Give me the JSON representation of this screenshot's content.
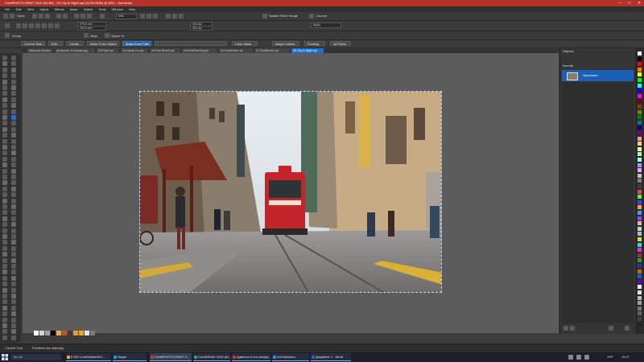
{
  "window": {
    "title": "CorelPHOTO-PAINT 2019 (64-Bit) - 06 City to Night.cpt (24-Bit RGB) @ 66% - Openimen",
    "controls": [
      "–",
      "□",
      "✕"
    ]
  },
  "menu": [
    "File",
    "Edit",
    "View",
    "Adjust",
    "Effects",
    "Mask",
    "Object",
    "Tools",
    "Window",
    "Help"
  ],
  "toolbar": {
    "open_label": "Open",
    "zoom_value": "66%",
    "split_label": "Splash Entire Image",
    "launch_label": "Launch"
  },
  "property_bar": {
    "width_value": "375.9 mm",
    "height_value": "250.9 mm",
    "res1": "300 dpi",
    "res2": "300 dpi",
    "apply_label": "Apply"
  },
  "group_row": {
    "group_label": "Group",
    "align_label": "Align",
    "space_label": "Space To"
  },
  "mask_row": {
    "buttons": [
      "Current Sele...",
      "Edit",
      "Create",
      "Mask From Object",
      "Mask From Path",
      "",
      "Color Mask",
      "Magic Outline",
      "Floating",
      "All Paths"
    ]
  },
  "tabs": [
    "Welcome Screen",
    "qb.woman 14 woman.jpg",
    "02-Flywr.cpt",
    "03-Hands Lie.cpt",
    "04-Feel Beach.cpt",
    "05-ScribPainting.cpt",
    "06-ScribPatch.cpt",
    "07-ScribBrush.cpt",
    "08-City to Night.cpt"
  ],
  "active_tab": 8,
  "objects_panel": {
    "title": "Objects",
    "subtitle": "Normal",
    "layer_name": "Openimen"
  },
  "status": {
    "tool_label": "Current Tool",
    "hint": "Positions the object(s)"
  },
  "taskbar": {
    "search": "Au. Al",
    "items": [
      {
        "label": "E:\\05-CorelMarketSIS...",
        "color": "#e0b23a"
      },
      {
        "label": "Skype",
        "color": "#1e9bd7"
      },
      {
        "label": "CorelPHOTO-PAINT 2...",
        "color": "#c33b2d"
      },
      {
        "label": "CorelDRAW 2019 (64...",
        "color": "#2fa54e"
      },
      {
        "label": "Адвенок 6 что конфір...",
        "color": "#d9331e"
      },
      {
        "label": "GoToAdvisor",
        "color": "#4c7de0"
      },
      {
        "label": "Документ 1 - Word",
        "color": "#2b5bb8"
      }
    ],
    "lang": "УКР",
    "time": "18:27"
  },
  "colors": {
    "accent": "#1c6fd6",
    "titlebar": "#b3332a"
  }
}
